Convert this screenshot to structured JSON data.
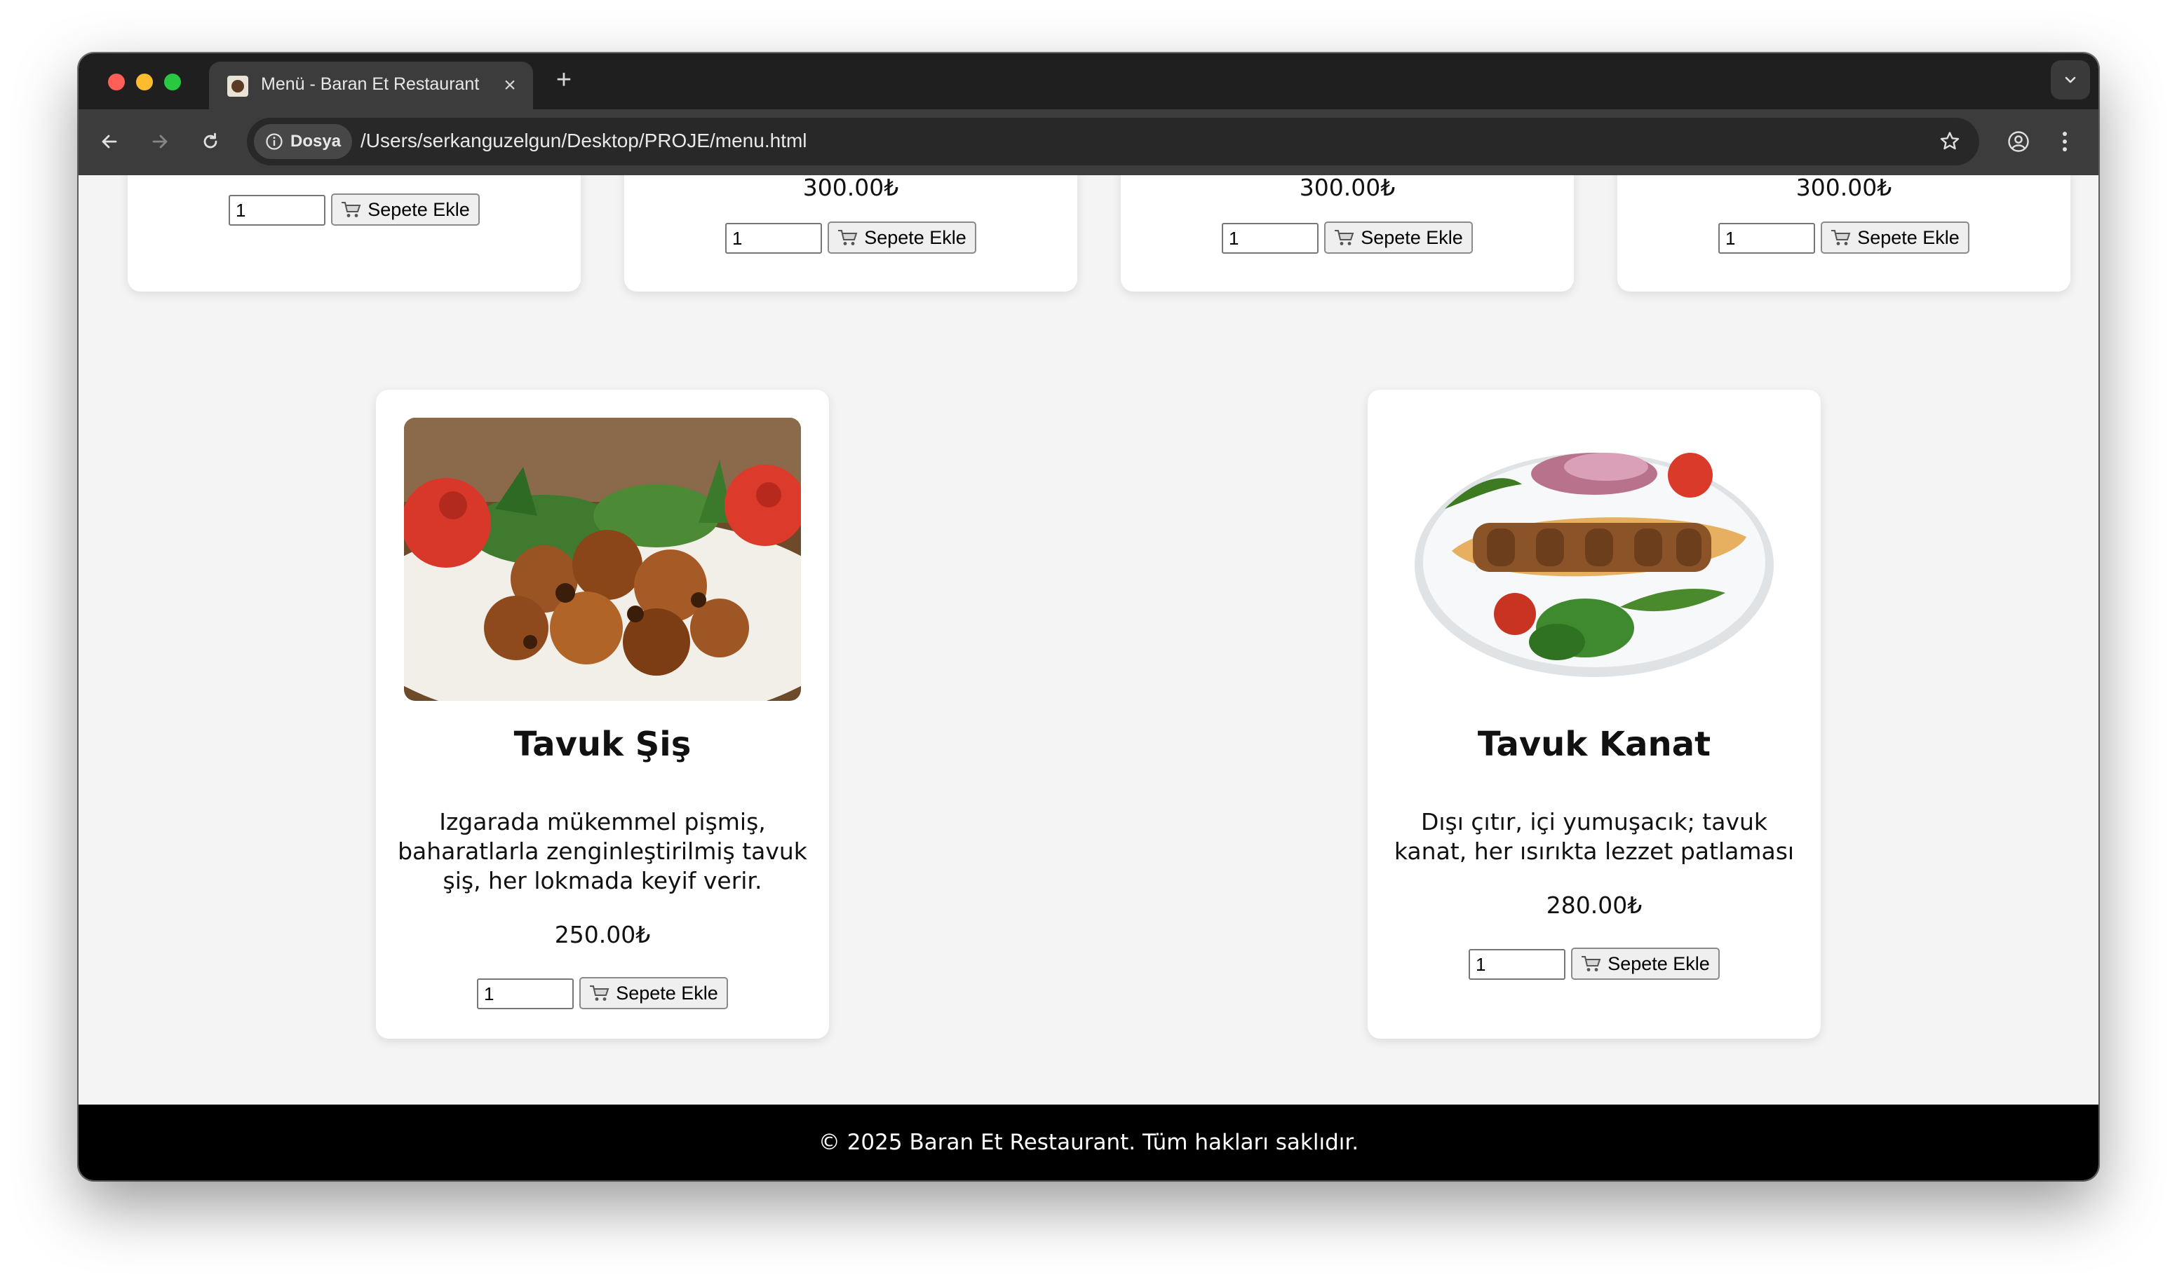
{
  "browser": {
    "tab_title": "Menü - Baran Et Restaurant",
    "tab_close": "×",
    "new_tab": "+",
    "site_info": "Dosya",
    "url": "/Users/serkanguzelgun/Desktop/PROJE/menu.html"
  },
  "top_cards": [
    {
      "price": "",
      "qty": "1",
      "button": "Sepete Ekle"
    },
    {
      "price": "300.00₺",
      "qty": "1",
      "button": "Sepete Ekle"
    },
    {
      "price": "300.00₺",
      "qty": "1",
      "button": "Sepete Ekle"
    },
    {
      "price": "300.00₺",
      "qty": "1",
      "button": "Sepete Ekle"
    }
  ],
  "products": [
    {
      "name": "Tavuk Şiş",
      "description": "Izgarada mükemmel pişmiş, baharatlarla zenginleştirilmiş tavuk şiş, her lokmada keyif verir.",
      "price": "250.00₺",
      "qty": "1",
      "button": "Sepete Ekle"
    },
    {
      "name": "Tavuk Kanat",
      "description": "Dışı çıtır, içi yumuşacık; tavuk kanat, her ısırıkta lezzet patlaması",
      "price": "280.00₺",
      "qty": "1",
      "button": "Sepete Ekle"
    }
  ],
  "footer": {
    "text": "© 2025 Baran Et Restaurant. Tüm hakları saklıdır."
  },
  "icons": {
    "cart": "shopping-cart-icon",
    "info": "info-icon",
    "star": "bookmark-star-icon",
    "profile": "profile-icon",
    "menu": "kebab-menu-icon"
  },
  "colors": {
    "page_bg": "#f4f4f4",
    "card_bg": "#ffffff",
    "footer_bg": "#000000",
    "footer_text": "#ffffff",
    "chrome_dark": "#1f1f1f",
    "chrome_toolbar": "#3c3c3c"
  }
}
